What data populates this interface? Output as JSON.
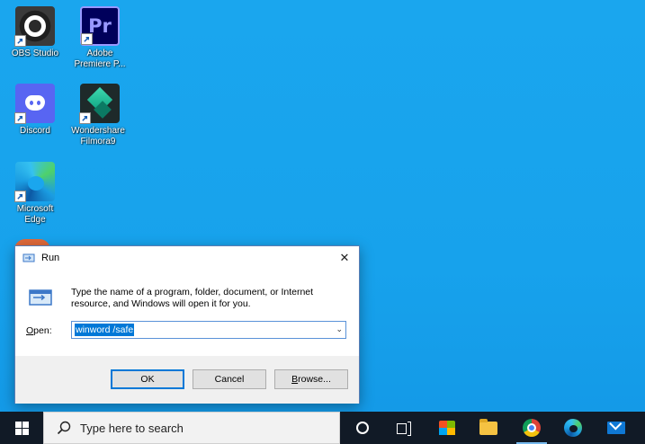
{
  "desktop": {
    "icons": [
      {
        "label": "OBS Studio",
        "icon": "obs-studio-icon"
      },
      {
        "label": "Adobe Premiere P...",
        "icon": "premiere-icon",
        "glyph": "Pr"
      },
      {
        "label": "Discord",
        "icon": "discord-icon"
      },
      {
        "label": "Wondershare Filmora9",
        "icon": "filmora-icon"
      },
      {
        "label": "Microsoft Edge",
        "icon": "edge-icon"
      }
    ]
  },
  "run_dialog": {
    "title": "Run",
    "close_glyph": "✕",
    "description": "Type the name of a program, folder, document, or Internet resource, and Windows will open it for you.",
    "open_label_accel": "O",
    "open_label_rest": "pen:",
    "input_value": "winword /safe",
    "dropdown_glyph": "⌄",
    "buttons": {
      "ok": "OK",
      "cancel": "Cancel",
      "browse_accel": "B",
      "browse_rest": "rowse..."
    }
  },
  "taskbar": {
    "search_placeholder": "Type here to search",
    "apps": [
      "cortana",
      "task-view",
      "microsoft-store",
      "file-explorer",
      "chrome",
      "edge",
      "mail"
    ]
  }
}
